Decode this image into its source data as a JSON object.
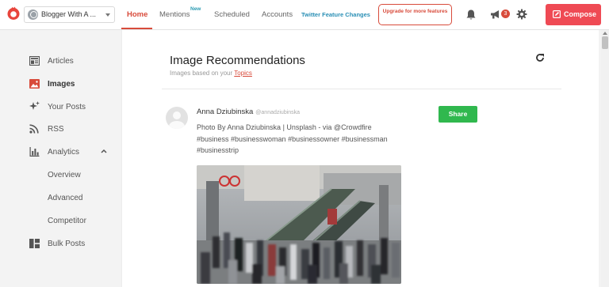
{
  "header": {
    "account_name": "Blogger With A ...",
    "nav": [
      {
        "id": "home",
        "label": "Home",
        "active": true
      },
      {
        "id": "mentions",
        "label": "Mentions"
      },
      {
        "id": "scheduled",
        "label": "Scheduled"
      },
      {
        "id": "accounts",
        "label": "Accounts"
      }
    ],
    "new_badge": "New",
    "twitter_changes": "Twitter Feature Changes",
    "upgrade_label": "Upgrade for more features",
    "notification_count": "3",
    "compose_label": "Compose",
    "accent_color": "#d84b3b",
    "compose_color": "#ef4a54"
  },
  "sidebar": {
    "items": [
      {
        "label": "Articles",
        "icon": "articles-icon"
      },
      {
        "label": "Images",
        "icon": "image-icon",
        "active": true
      },
      {
        "label": "Your Posts",
        "icon": "sparkle-icon"
      },
      {
        "label": "RSS",
        "icon": "rss-icon"
      },
      {
        "label": "Analytics",
        "icon": "bar-chart-icon",
        "expanded": true
      },
      {
        "label": "Overview"
      },
      {
        "label": "Advanced"
      },
      {
        "label": "Competitor"
      },
      {
        "label": "Bulk Posts",
        "icon": "layout-icon"
      }
    ]
  },
  "main": {
    "title": "Image Recommendations",
    "subtitle_prefix": "Images based on your",
    "topics_link": "Topics",
    "post": {
      "author": "Anna Dziubinska",
      "handle": "@annadziubinska",
      "text": "Photo By Anna Dziubinska | Unsplash - via @Crowdfire #business #businesswoman #businessowner #businessman #businesstrip",
      "share_label": "Share",
      "share_color": "#30b84e"
    }
  }
}
